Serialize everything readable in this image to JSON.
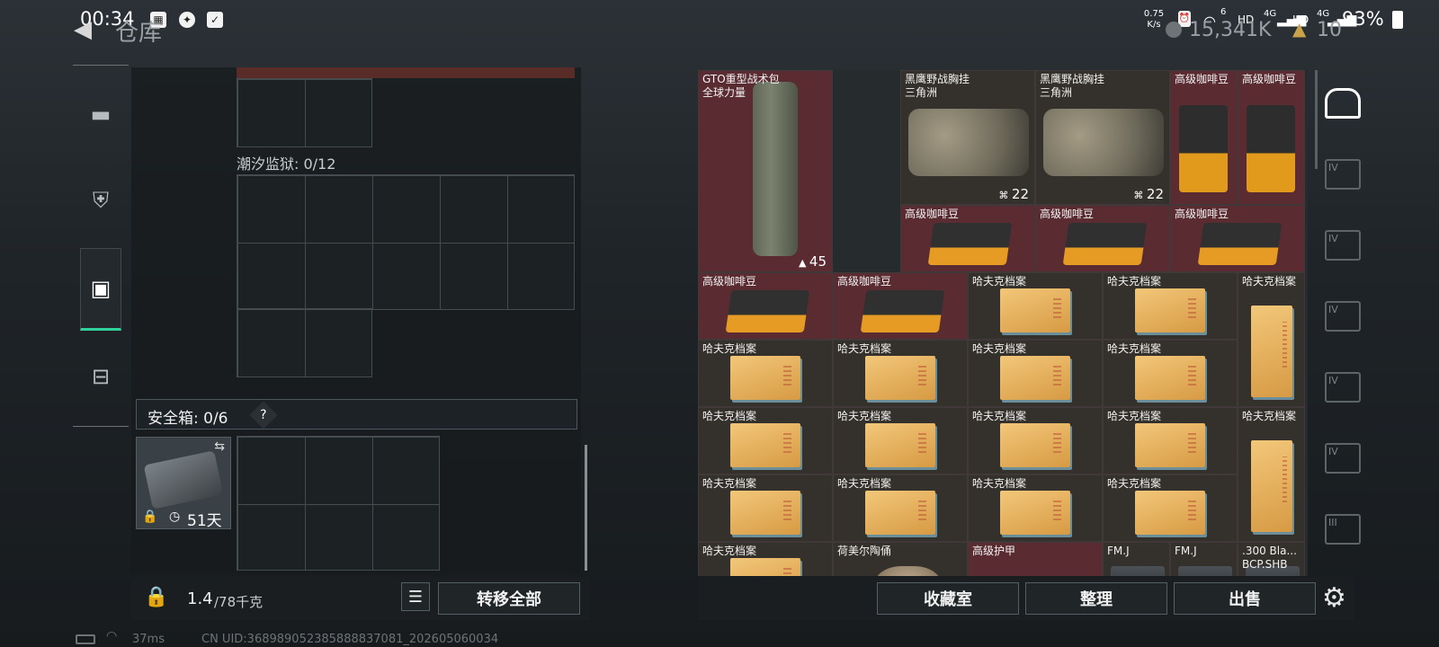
{
  "status_bar": {
    "time": "00:34",
    "net_speed_top": "0.75",
    "net_speed_bottom": "K/s",
    "signal1": "6",
    "hd1": "HD",
    "net1": "4G",
    "hd2": "HD",
    "net2": "4G",
    "battery": "93%"
  },
  "header": {
    "back_icon": "back-arrow-icon",
    "title": "仓库",
    "currency_amount": "15,341K",
    "currency2_amount": "10"
  },
  "left_nav": {
    "items": [
      {
        "name": "weapon",
        "icon": "pistol-icon",
        "glyph": "⌐"
      },
      {
        "name": "gear",
        "icon": "armor-icon",
        "glyph": "⛨"
      },
      {
        "name": "backpack",
        "icon": "backpack-icon",
        "glyph": "▣",
        "active": true
      },
      {
        "name": "tools",
        "icon": "toolbox-icon",
        "glyph": "⌂"
      }
    ]
  },
  "left_panel": {
    "container1_label": "潮汐监狱: 0/12",
    "safe_box_label": "安全箱: 0/6",
    "safe_box_help": "?",
    "safe_box_timer": "51天",
    "weight_current": "1.4",
    "weight_max": "/78千克",
    "transfer_all": "转移全部"
  },
  "stash": {
    "items": [
      {
        "name": "GTO重型战术包",
        "sub": "全球力量",
        "count": "45",
        "kind": "backpack",
        "bg": "red"
      },
      {
        "name": "黑鹰野战胸挂",
        "sub": "三角洲",
        "count": "22",
        "kind": "vest",
        "bg": "dark"
      },
      {
        "name": "黑鹰野战胸挂",
        "sub": "三角洲",
        "count": "22",
        "kind": "vest",
        "bg": "dark"
      },
      {
        "name": "高级咖啡豆",
        "kind": "coffee",
        "bg": "red"
      },
      {
        "name": "高级咖啡豆",
        "kind": "coffee",
        "bg": "red"
      },
      {
        "name": "高级咖啡豆",
        "kind": "coffeeflat",
        "bg": "red"
      },
      {
        "name": "高级咖啡豆",
        "kind": "coffeeflat",
        "bg": "red"
      },
      {
        "name": "高级咖啡豆",
        "kind": "coffeeflat",
        "bg": "red"
      },
      {
        "name": "高级咖啡豆",
        "kind": "coffeeflat",
        "bg": "red"
      },
      {
        "name": "高级咖啡豆",
        "kind": "coffeeflat",
        "bg": "red"
      },
      {
        "name": "哈夫克档案",
        "kind": "doc",
        "bg": "dark"
      },
      {
        "name": "哈夫克档案",
        "kind": "doc",
        "bg": "dark"
      },
      {
        "name": "哈夫克档案",
        "kind": "doctall",
        "bg": "dark"
      },
      {
        "name": "哈夫克档案",
        "kind": "doc",
        "bg": "dark"
      },
      {
        "name": "哈夫克档案",
        "kind": "doc",
        "bg": "dark"
      },
      {
        "name": "哈夫克档案",
        "kind": "doc",
        "bg": "dark"
      },
      {
        "name": "哈夫克档案",
        "kind": "doc",
        "bg": "dark"
      },
      {
        "name": "哈夫克档案",
        "kind": "doc",
        "bg": "dark"
      },
      {
        "name": "哈夫克档案",
        "kind": "doc",
        "bg": "dark"
      },
      {
        "name": "哈夫克档案",
        "kind": "doc",
        "bg": "dark"
      },
      {
        "name": "哈夫克档案",
        "kind": "doc",
        "bg": "dark"
      },
      {
        "name": "哈夫克档案",
        "kind": "doctall",
        "bg": "dark"
      },
      {
        "name": "哈夫克档案",
        "kind": "doc",
        "bg": "dark"
      },
      {
        "name": "哈夫克档案",
        "kind": "doc",
        "bg": "dark"
      },
      {
        "name": "哈夫克档案",
        "kind": "doc",
        "bg": "dark"
      },
      {
        "name": "哈夫克档案",
        "kind": "doc",
        "bg": "dark"
      },
      {
        "name": "哈夫克档案",
        "kind": "doc",
        "bg": "dark"
      },
      {
        "name": "荷美尔陶俑",
        "kind": "figure",
        "bg": "dark"
      },
      {
        "name": "高级护甲",
        "kind": "none",
        "bg": "red"
      },
      {
        "name": "FM.J",
        "kind": "ammo",
        "bg": "dark"
      },
      {
        "name": "FM.J",
        "kind": "ammo",
        "bg": "dark"
      },
      {
        "name": ".300 Bla...",
        "sub": "BCP.SHB",
        "kind": "ammo",
        "bg": "dark"
      }
    ]
  },
  "right_sidebar": {
    "items": [
      {
        "label": "",
        "icon": "stash-tab-icon"
      },
      {
        "label": "IV",
        "icon": "storage-tab-icon"
      },
      {
        "label": "IV",
        "icon": "storage-tab-icon"
      },
      {
        "label": "IV",
        "icon": "storage-tab-icon"
      },
      {
        "label": "IV",
        "icon": "storage-tab-icon"
      },
      {
        "label": "IV",
        "icon": "storage-tab-icon"
      },
      {
        "label": "III",
        "icon": "storage-tab-icon"
      }
    ],
    "settings_icon": "gear-icon"
  },
  "bottom_right": {
    "collection": "收藏室",
    "sort": "整理",
    "sell": "出售"
  },
  "footer": {
    "ping": "37ms",
    "uid": "CN UID:3689890523858888370​81_202605060034"
  }
}
